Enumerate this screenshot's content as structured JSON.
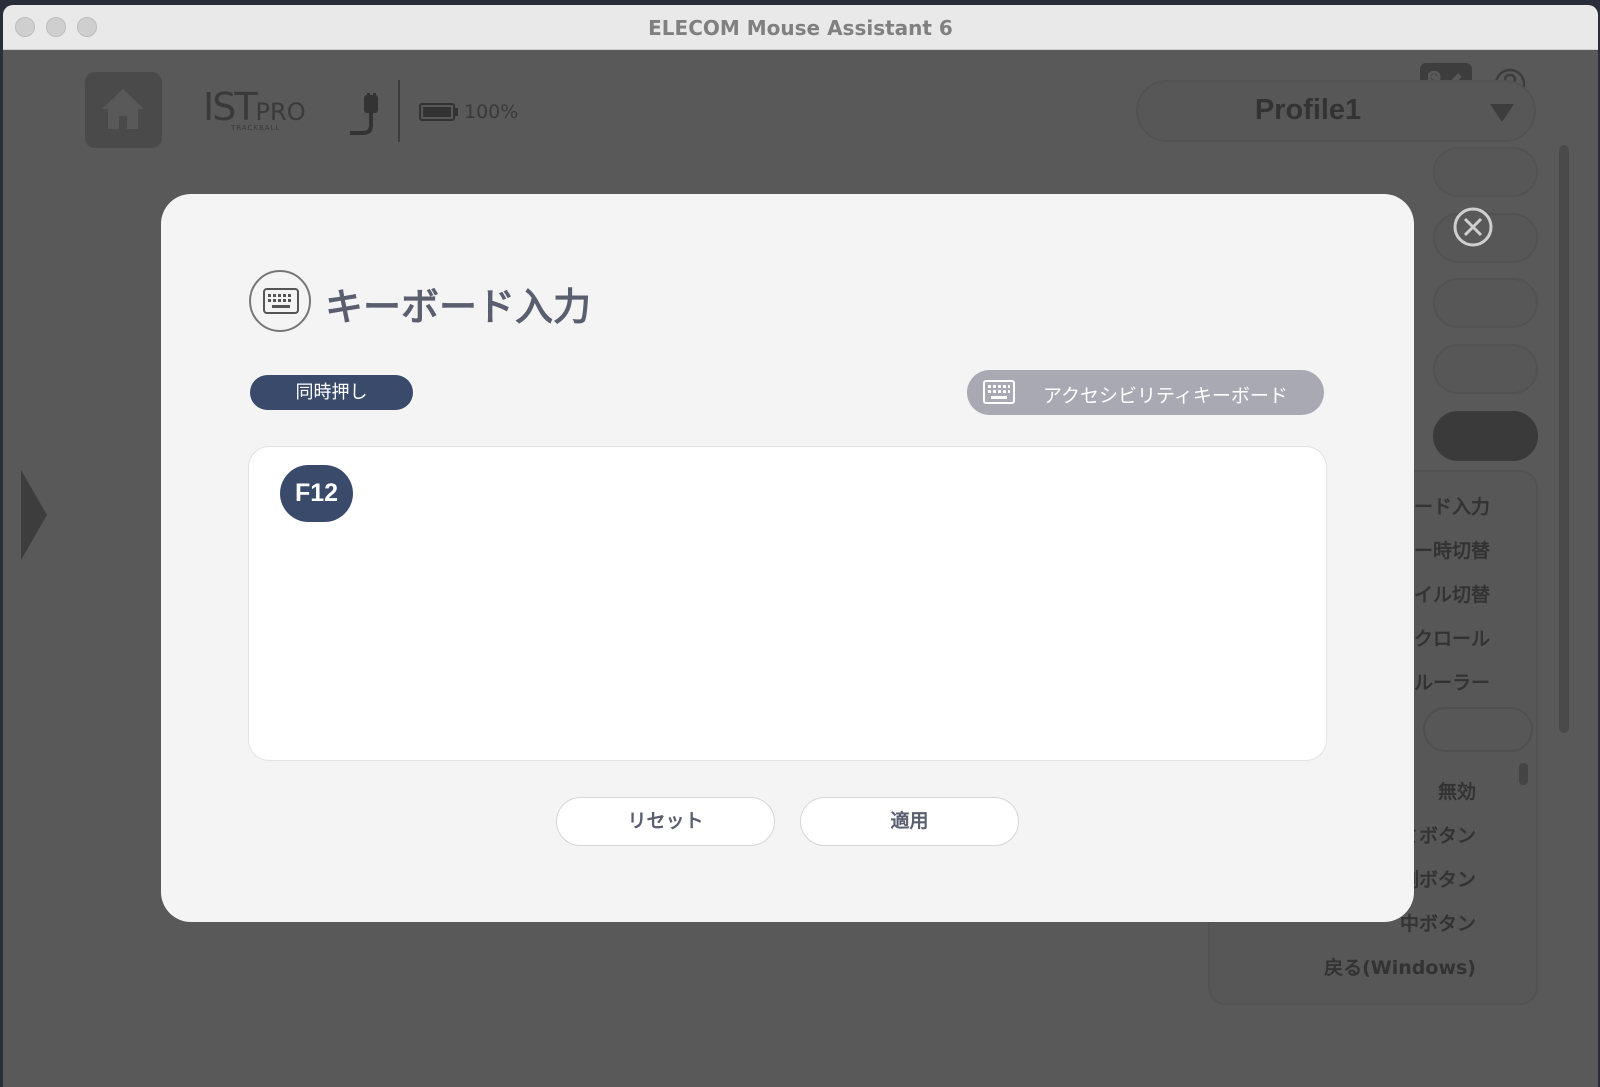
{
  "window": {
    "title": "ELECOM Mouse Assistant 6"
  },
  "device": {
    "logo_main": "IST",
    "logo_pro": "PRO",
    "logo_sub": "TRACKBALL",
    "battery": "100%"
  },
  "profile": {
    "selected": "Profile1"
  },
  "function_list": {
    "items": [
      "ード入力",
      "ー時切替",
      "イル切替",
      "クロール",
      "ルーラー"
    ],
    "items2": [
      "無効",
      "ミボタン",
      "側ボタン",
      "中ボタン",
      "戻る(Windows)"
    ]
  },
  "modal": {
    "title": "キーボード入力",
    "simultaneous_label": "同時押し",
    "accessibility_keyboard_label": "アクセシビリティキーボード",
    "keys": [
      "F12"
    ],
    "reset_label": "リセット",
    "apply_label": "適用"
  },
  "icons": {
    "home": "home-icon",
    "cable": "usb-cable-icon",
    "battery": "battery-icon",
    "tools": "tools-icon",
    "help": "help-icon",
    "close": "close-icon",
    "keyboard": "keyboard-icon"
  },
  "colors": {
    "accent": "#3a4a6b",
    "modal_bg": "#f4f4f4",
    "overlay": "#595959"
  }
}
